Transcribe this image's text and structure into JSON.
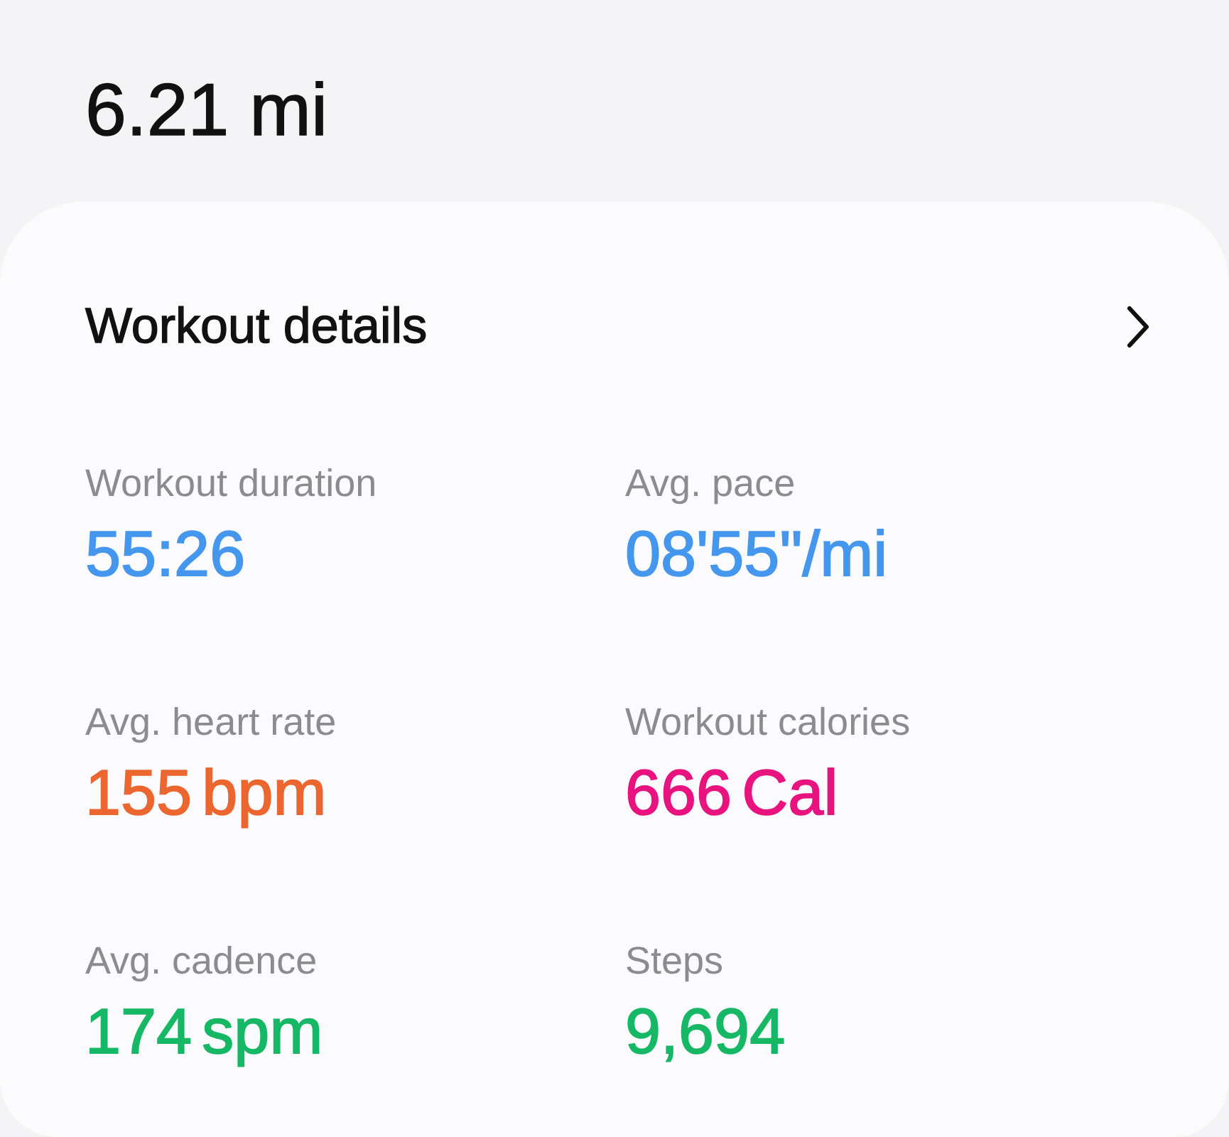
{
  "distance": "6.21 mi",
  "card": {
    "title": "Workout details",
    "stats": [
      {
        "label": "Workout duration",
        "value": "55:26",
        "color": "#4597ee"
      },
      {
        "label": "Avg. pace",
        "value": "08'55\"/mi",
        "color": "#4597ee"
      },
      {
        "label": "Avg. heart rate",
        "value": "155 bpm",
        "color": "#ec6630"
      },
      {
        "label": "Workout calories",
        "value": "666 Cal",
        "color": "#e8137f"
      },
      {
        "label": "Avg. cadence",
        "value": "174 spm",
        "color": "#16b865"
      },
      {
        "label": "Steps",
        "value": "9,694",
        "color": "#16b865"
      }
    ]
  }
}
